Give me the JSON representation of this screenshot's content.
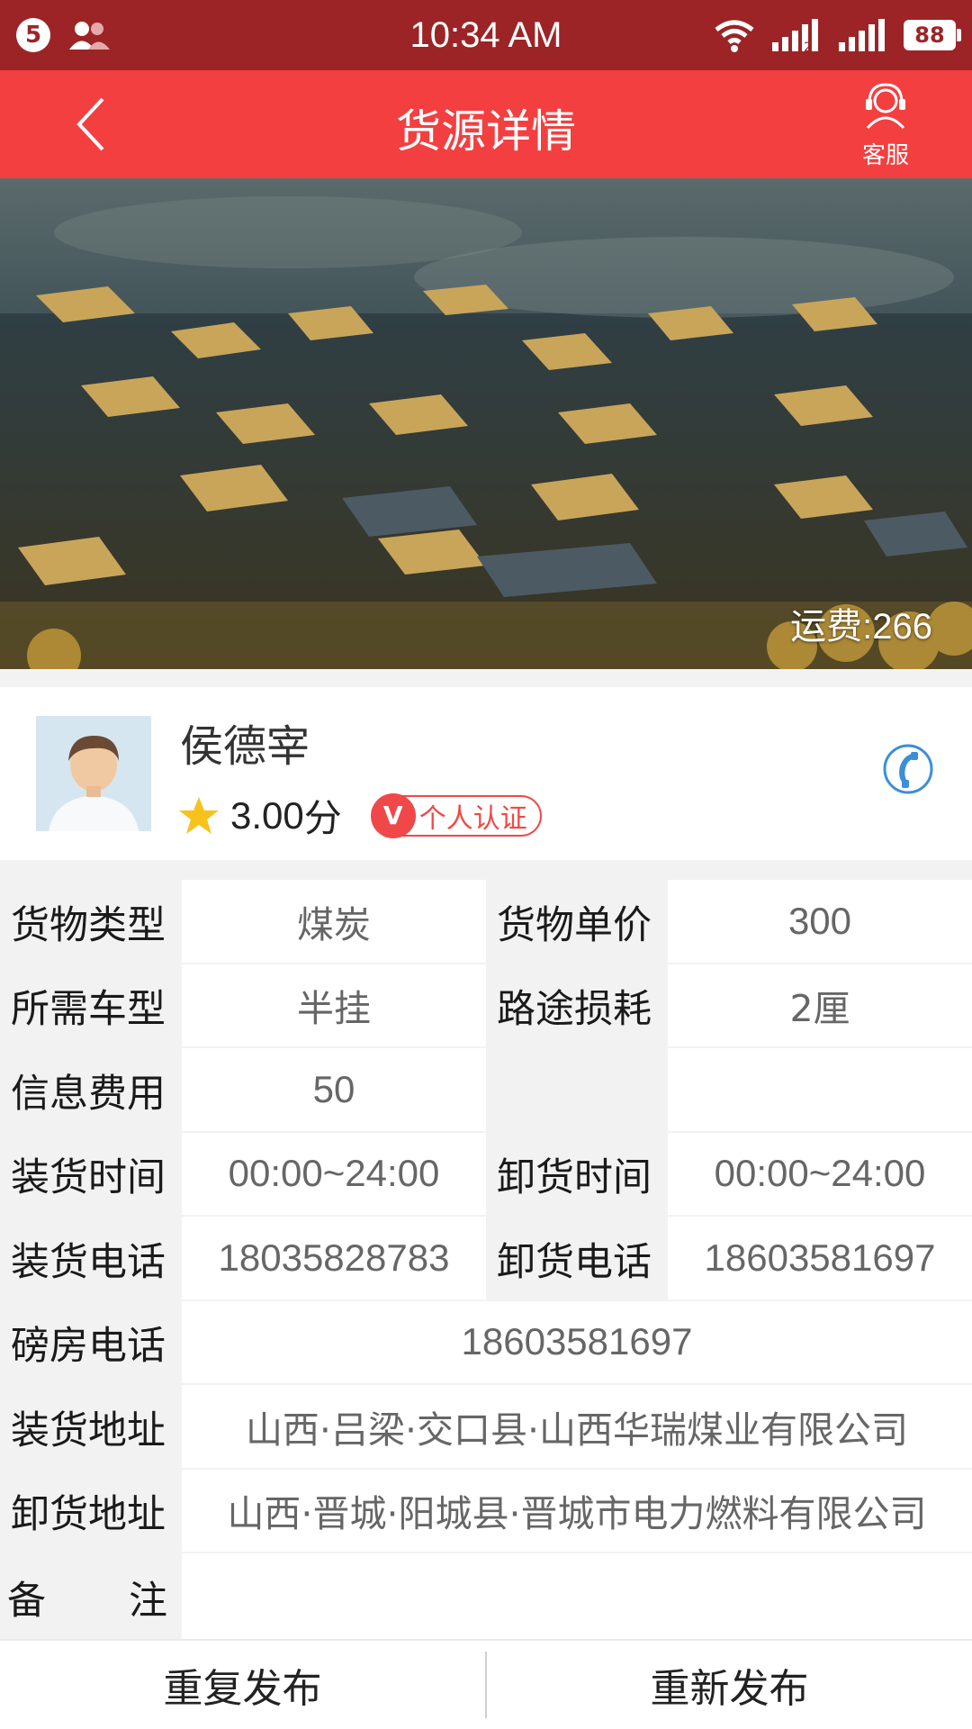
{
  "status_bar": {
    "notification_count": "5",
    "time": "10:34 AM",
    "battery": "88",
    "signal_sub": "2"
  },
  "header": {
    "title": "货源详情",
    "service_label": "客服"
  },
  "banner": {
    "fee_text": "运费:266"
  },
  "profile": {
    "name": "侯德宰",
    "score": "3.00",
    "score_unit": "分",
    "cert_badge": "V",
    "cert_label": "个人认证"
  },
  "details": {
    "cargo_type_label": "货物类型",
    "cargo_type": "煤炭",
    "unit_price_label": "货物单价",
    "unit_price": "300",
    "vehicle_type_label": "所需车型",
    "vehicle_type": "半挂",
    "loss_label": "路途损耗",
    "loss": "2厘",
    "info_fee_label": "信息费用",
    "info_fee": "50",
    "load_time_label": "装货时间",
    "load_time": "00:00~24:00",
    "unload_time_label": "卸货时间",
    "unload_time": "00:00~24:00",
    "load_phone_label": "装货电话",
    "load_phone": "18035828783",
    "unload_phone_label": "卸货电话",
    "unload_phone": "18603581697",
    "weigh_phone_label": "磅房电话",
    "weigh_phone": "18603581697",
    "load_address_label": "装货地址",
    "load_address": "山西·吕梁·交口县·山西华瑞煤业有限公司",
    "unload_address_label": "卸货地址",
    "unload_address": "山西·晋城·阳城县·晋城市电力燃料有限公司",
    "remarks_label_1": "备",
    "remarks_label_2": "注",
    "remarks": ""
  },
  "footer": {
    "repeat_publish": "重复发布",
    "republish": "重新发布"
  }
}
